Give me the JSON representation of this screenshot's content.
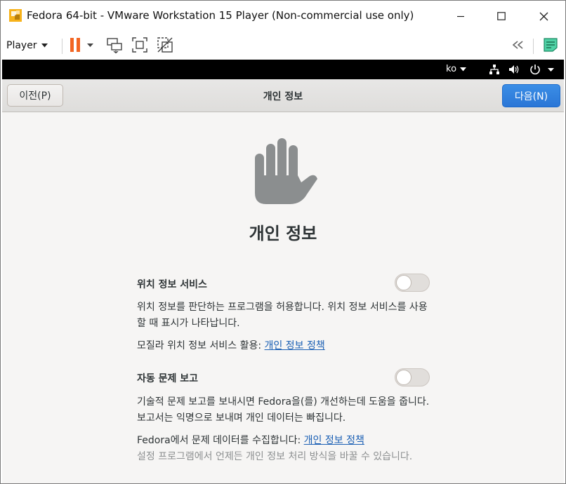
{
  "window": {
    "title": "Fedora 64-bit - VMware Workstation 15 Player (Non-commercial use only)",
    "controls": [
      "minimize",
      "maximize",
      "close"
    ]
  },
  "toolbar": {
    "player_label": "Player",
    "icons": [
      "pause-icon",
      "send-ctrl-alt-del-icon",
      "fullscreen-icon",
      "unity-icon",
      "collapse-toolbar-icon",
      "message-log-icon"
    ],
    "pause_color": "#f26522"
  },
  "guest_topbar": {
    "language": "ko",
    "status_icons": [
      "network-icon",
      "volume-icon",
      "power-icon"
    ]
  },
  "headerbar": {
    "prev_label": "이전(P)",
    "title": "개인 정보",
    "next_label": "다음(N)",
    "next_color": "#3584e4"
  },
  "page": {
    "heading": "개인 정보",
    "hero_icon": "privacy-hand-icon",
    "location": {
      "title": "위치 정보 서비스",
      "enabled": false,
      "description": "위치 정보를 판단하는 프로그램을 허용합니다. 위치 정보 서비스를 사용할 때 표시가 나타납니다.",
      "policy_prefix": "모질라 위치 정보 서비스 활용: ",
      "policy_link": "개인 정보 정책"
    },
    "problem_reporting": {
      "title": "자동 문제 보고",
      "enabled": false,
      "description": "기술적 문제 보고를 보내시면 Fedora을(를) 개선하는데 도움을 줍니다. 보고서는 익명으로 보내며 개인 데이터는 빠집니다.",
      "policy_prefix": "Fedora에서 문제 데이터를 수집합니다: ",
      "policy_link": "개인 정보 정책"
    },
    "footer_note": "설정 프로그램에서 언제든 개인 정보 처리 방식을 바꿀 수 있습니다."
  }
}
